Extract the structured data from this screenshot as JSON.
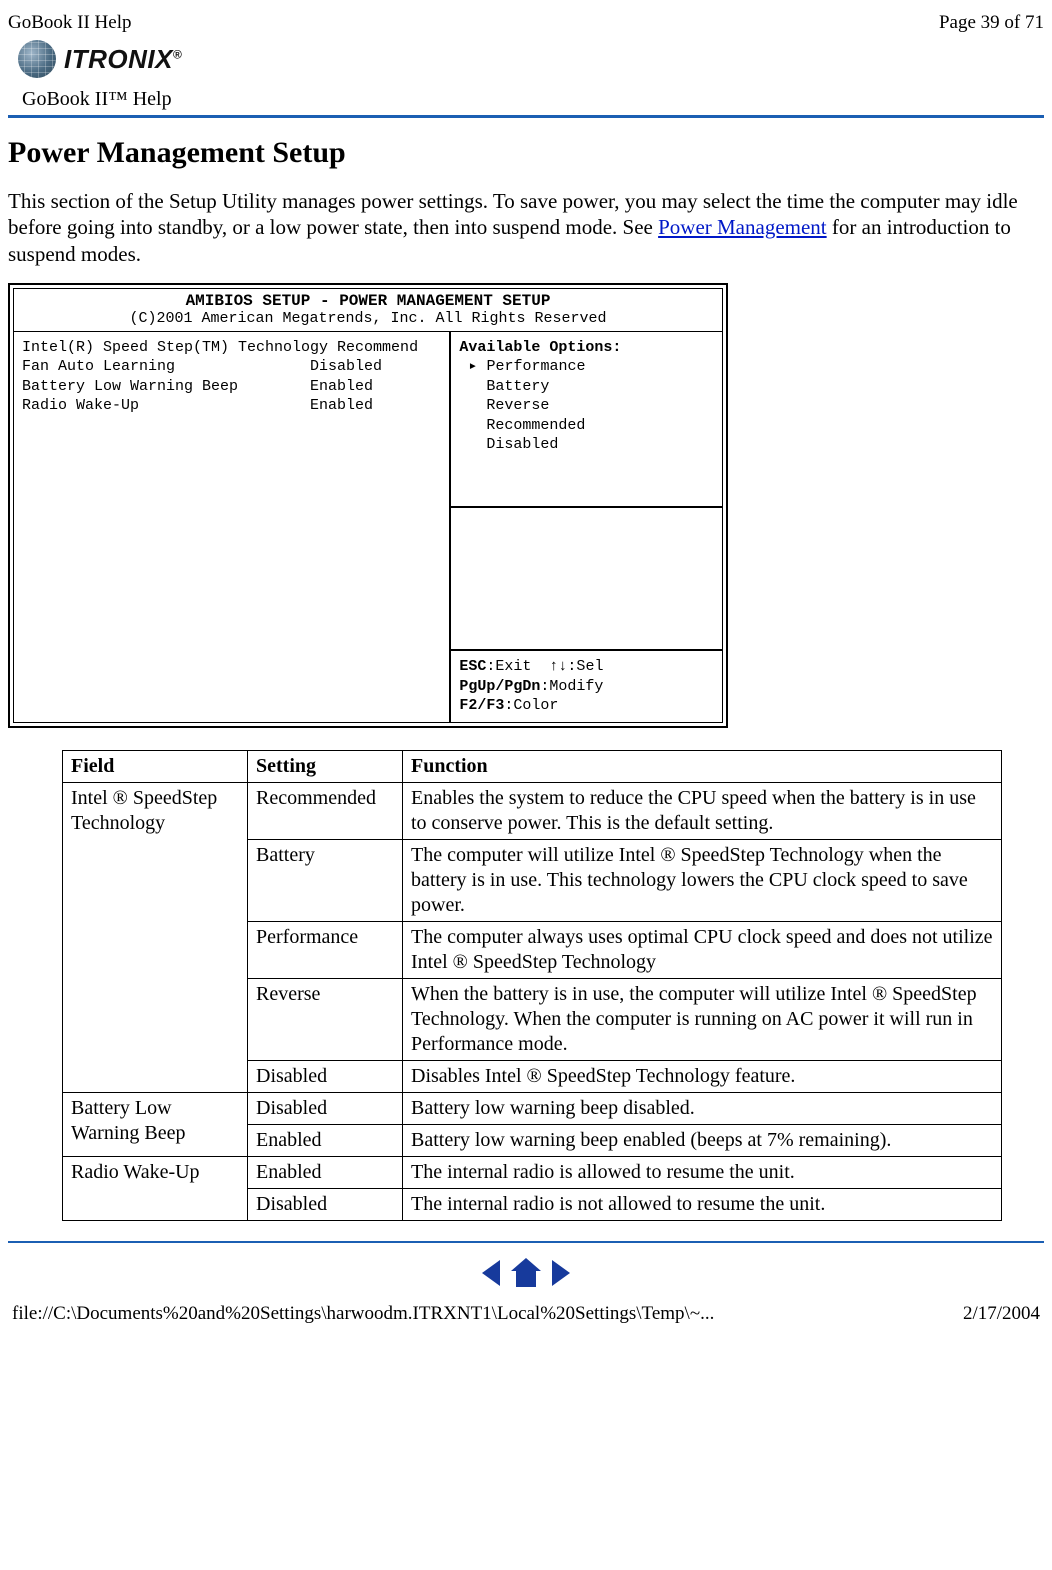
{
  "header": {
    "doc_title": "GoBook II Help",
    "page_indicator": "Page 39 of 71",
    "brand": "ITRONIX",
    "brand_reg": "®",
    "help_label": "GoBook II™ Help"
  },
  "section": {
    "title": "Power Management Setup",
    "intro_pre": "This section of the Setup Utility manages power settings.  To save power, you may select the time the computer may idle before going into standby, or a low power state, then into suspend mode.  See ",
    "intro_link": "Power Management",
    "intro_post": " for an introduction to suspend modes."
  },
  "bios": {
    "title": "AMIBIOS SETUP - POWER MANAGEMENT SETUP",
    "copyright": "(C)2001 American Megatrends, Inc. All Rights Reserved",
    "left_lines": "Intel(R) Speed Step(TM) Technology Recommend\nFan Auto Learning               Disabled\nBattery Low Warning Beep        Enabled\nRadio Wake-Up                   Enabled",
    "opts_title": "Available Options:",
    "opts_lines": " ▸ Performance\n   Battery\n   Reverse\n   Recommended\n   Disabled",
    "hints": "ESC:Exit  ↑↓:Sel\nPgUp/PgDn:Modify\nF2/F3:Color",
    "hints_l1a": "ESC",
    "hints_l1b": ":Exit  ↑↓:Sel",
    "hints_l2a": "PgUp/PgDn",
    "hints_l2b": ":Modify",
    "hints_l3a": "F2/F3",
    "hints_l3b": ":Color"
  },
  "table": {
    "headers": {
      "field": "Field",
      "setting": "Setting",
      "function": "Function"
    },
    "rows": [
      {
        "field": "Intel ® SpeedStep Technology",
        "setting": "Recommended",
        "function": "Enables the system to reduce the CPU speed when the battery is in use to conserve power. This is the default setting."
      },
      {
        "field": "",
        "setting": "Battery",
        "function": "The computer will utilize Intel ® SpeedStep Technology when the battery is in use.  This technology lowers the CPU clock speed to save power."
      },
      {
        "field": "",
        "setting": "Performance",
        "function": "The computer always uses optimal CPU clock speed and does not utilize Intel ® SpeedStep Technology"
      },
      {
        "field": "",
        "setting": "Reverse",
        "function": "When the battery is in use, the computer will utilize Intel ® SpeedStep Technology.  When the computer is running on AC power it will run in Performance mode."
      },
      {
        "field": "",
        "setting": "Disabled",
        "function": "Disables Intel ® SpeedStep Technology feature."
      },
      {
        "field": "Battery Low Warning Beep",
        "setting": "Disabled",
        "function": "Battery low warning beep disabled."
      },
      {
        "field": "",
        "setting": "Enabled",
        "function": "Battery low warning beep enabled (beeps at 7% remaining)."
      },
      {
        "field": "Radio Wake-Up",
        "setting": "Enabled",
        "function": "The internal radio is allowed to resume the unit."
      },
      {
        "field": "",
        "setting": "Disabled",
        "function": "The internal radio is not allowed to resume the unit."
      }
    ]
  },
  "footer": {
    "path": "file://C:\\Documents%20and%20Settings\\harwoodm.ITRXNT1\\Local%20Settings\\Temp\\~...",
    "date": "2/17/2004"
  },
  "nav": {
    "prev": "prev-icon",
    "home": "home-icon",
    "next": "next-icon"
  }
}
